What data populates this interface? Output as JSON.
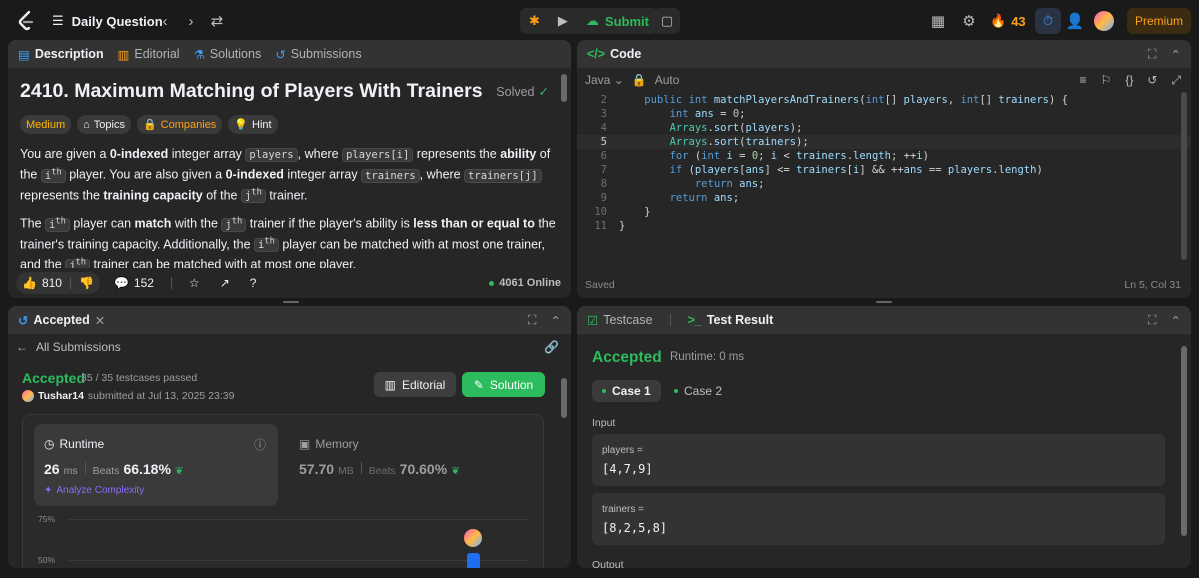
{
  "topbar": {
    "title": "Daily Question",
    "submit_label": "Submit",
    "streak": "43",
    "premium_label": "Premium",
    "icons": [
      "leetcode-logo",
      "list-icon",
      "chevron-left-icon",
      "chevron-right-icon",
      "shuffle-icon",
      "debug-icon",
      "play-icon",
      "cloud-upload-icon",
      "note-icon",
      "grid-icon",
      "gear-icon",
      "fire-icon",
      "timer-icon",
      "add-user-icon",
      "avatar"
    ]
  },
  "description": {
    "tabs": [
      {
        "label": "Description",
        "active": true
      },
      {
        "label": "Editorial"
      },
      {
        "label": "Solutions"
      },
      {
        "label": "Submissions"
      }
    ],
    "title": "2410. Maximum Matching of Players With Trainers",
    "solved_label": "Solved",
    "tags": {
      "difficulty": "Medium",
      "topics": "Topics",
      "companies": "Companies",
      "hint": "Hint"
    },
    "para1": {
      "t1": "You are given a ",
      "b1": "0-indexed",
      "t2": " integer array ",
      "c1": "players",
      "t3": ", where ",
      "c2": "players[i]",
      "t4": " represents the ",
      "b2": "ability",
      "t5": " of the ",
      "c3": "i",
      "sup1": "th",
      "t6": " player. You are also given a ",
      "b3": "0-indexed",
      "t7": " integer array ",
      "c4": "trainers",
      "t8": ", where ",
      "c5": "trainers[j]",
      "t9": " represents the ",
      "b4": "training capacity",
      "t10": " of the ",
      "c6": "j",
      "sup2": "th",
      "t11": " trainer."
    },
    "para2": {
      "t1": "The ",
      "c1": "i",
      "sup1": "th",
      "t2": " player can ",
      "b1": "match",
      "t3": " with the ",
      "c2": "j",
      "sup2": "th",
      "t4": " trainer if the player's ability is ",
      "b2": "less than or equal to",
      "t5": " the trainer's training capacity. Additionally, the ",
      "c3": "i",
      "sup3": "th",
      "t6": " player can be matched with at most one trainer, and the ",
      "c4": "j",
      "sup4": "th",
      "t7": " trainer can be matched with at most one player."
    },
    "likes": "810",
    "comments": "152",
    "online": "4061 Online"
  },
  "code": {
    "tab_label": "Code",
    "language": "Java",
    "mode": "Auto",
    "status": "Saved",
    "cursor": "Ln 5, Col 31",
    "lines": [
      {
        "n": "2",
        "text": "    public int matchPlayersAndTrainers(int[] players, int[] trainers) {"
      },
      {
        "n": "3",
        "text": "        int ans = 0;"
      },
      {
        "n": "4",
        "text": "        Arrays.sort(players);"
      },
      {
        "n": "5",
        "text": "        Arrays.sort(trainers);"
      },
      {
        "n": "6",
        "text": "        for (int i = 0; i < trainers.length; ++i)"
      },
      {
        "n": "7",
        "text": "        if (players[ans] <= trainers[i] && ++ans == players.length)"
      },
      {
        "n": "8",
        "text": "            return ans;"
      },
      {
        "n": "9",
        "text": "        return ans;"
      },
      {
        "n": "10",
        "text": "    }"
      },
      {
        "n": "11",
        "text": "}"
      }
    ]
  },
  "accepted": {
    "tab_label": "Accepted",
    "back_label": "All Submissions",
    "status": "Accepted",
    "testcases": "35 / 35 testcases passed",
    "user": "Tushar14",
    "submitted": "submitted at Jul 13, 2025 23:39",
    "editorial_label": "Editorial",
    "solution_label": "Solution",
    "runtime_label": "Runtime",
    "runtime_value": "26",
    "runtime_unit": "ms",
    "beats_label": "Beats",
    "runtime_beats": "66.18%",
    "analyze_label": "Analyze Complexity",
    "memory_label": "Memory",
    "memory_value": "57.70",
    "memory_unit": "MB",
    "memory_beats": "70.60%",
    "axis_75": "75%",
    "axis_50": "50%"
  },
  "testresult": {
    "tab_testcase": "Testcase",
    "tab_result": "Test Result",
    "status": "Accepted",
    "runtime": "Runtime: 0 ms",
    "case1": "Case 1",
    "case2": "Case 2",
    "input_label": "Input",
    "players_label": "players =",
    "players_value": "[4,7,9]",
    "trainers_label": "trainers =",
    "trainers_value": "[8,2,5,8]",
    "output_label": "Output"
  },
  "colors": {
    "accent_green": "#2cbb5d",
    "accent_orange": "#ffa116",
    "medium_yellow": "#ffb800",
    "panel_bg": "#262626",
    "page_bg": "#1a1a1a"
  }
}
